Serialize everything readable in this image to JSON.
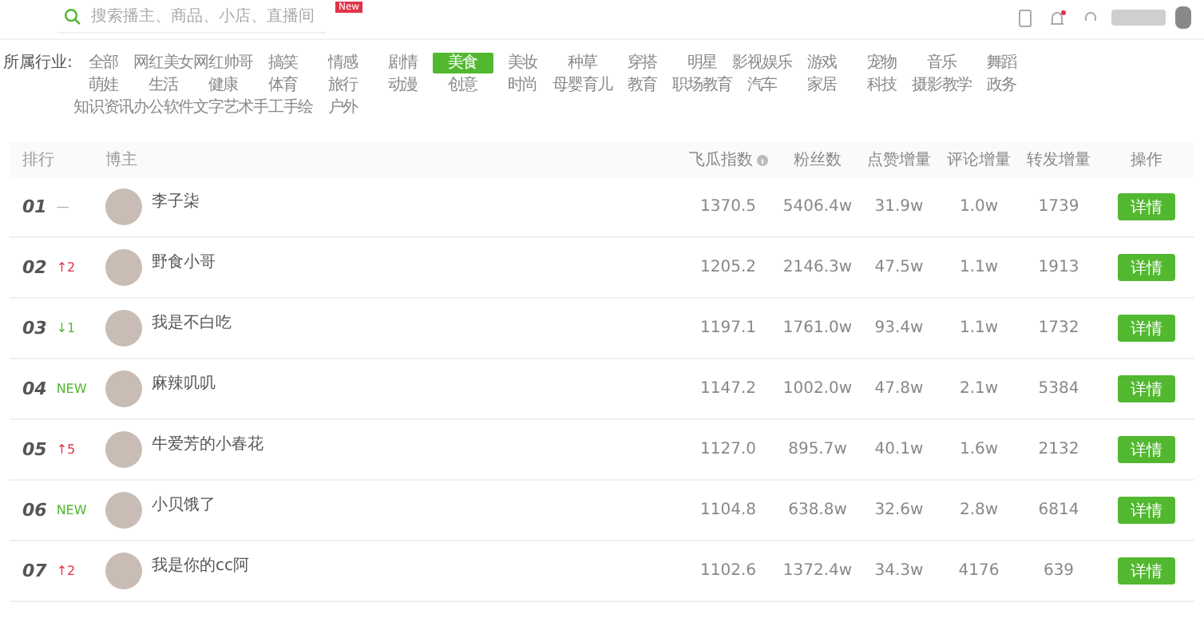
{
  "search": {
    "placeholder": "搜索播主、商品、小店、直播间"
  },
  "new_badge": "New",
  "industry": {
    "label": "所属行业:",
    "rows": [
      [
        {
          "label": "全部",
          "selected": false
        },
        {
          "label": "网红美女",
          "selected": false
        },
        {
          "label": "网红帅哥",
          "selected": false
        },
        {
          "label": "搞笑",
          "selected": false
        },
        {
          "label": "情感",
          "selected": false
        },
        {
          "label": "剧情",
          "selected": false
        },
        {
          "label": "美食",
          "selected": true
        },
        {
          "label": "美妆",
          "selected": false
        },
        {
          "label": "种草",
          "selected": false
        },
        {
          "label": "穿搭",
          "selected": false
        },
        {
          "label": "明星",
          "selected": false
        },
        {
          "label": "影视娱乐",
          "selected": false
        },
        {
          "label": "游戏",
          "selected": false
        },
        {
          "label": "宠物",
          "selected": false
        },
        {
          "label": "音乐",
          "selected": false
        },
        {
          "label": "舞蹈",
          "selected": false
        }
      ],
      [
        {
          "label": "萌娃",
          "selected": false
        },
        {
          "label": "生活",
          "selected": false
        },
        {
          "label": "健康",
          "selected": false
        },
        {
          "label": "体育",
          "selected": false
        },
        {
          "label": "旅行",
          "selected": false
        },
        {
          "label": "动漫",
          "selected": false
        },
        {
          "label": "创意",
          "selected": false
        },
        {
          "label": "时尚",
          "selected": false
        },
        {
          "label": "母婴育儿",
          "selected": false
        },
        {
          "label": "教育",
          "selected": false
        },
        {
          "label": "职场教育",
          "selected": false
        },
        {
          "label": "汽车",
          "selected": false
        },
        {
          "label": "家居",
          "selected": false
        },
        {
          "label": "科技",
          "selected": false
        },
        {
          "label": "摄影教学",
          "selected": false
        },
        {
          "label": "政务",
          "selected": false
        }
      ],
      [
        {
          "label": "知识资讯",
          "selected": false
        },
        {
          "label": "办公软件",
          "selected": false
        },
        {
          "label": "文字艺术",
          "selected": false
        },
        {
          "label": "手工手绘",
          "selected": false
        },
        {
          "label": "户外",
          "selected": false
        }
      ]
    ]
  },
  "table": {
    "columns": [
      "排行",
      "博主",
      "飞瓜指数",
      "粉丝数",
      "点赞增量",
      "评论增量",
      "转发增量",
      "操作"
    ],
    "rows": [
      {
        "rank": "01",
        "change": {
          "kind": "same",
          "text": "—"
        },
        "name": "李子柒",
        "index": "1370.5",
        "fans": "5406.4w",
        "likes": "31.9w",
        "comments": "1.0w",
        "shares": "1739",
        "action": "详情"
      },
      {
        "rank": "02",
        "change": {
          "kind": "up",
          "text": "↑2"
        },
        "name": "野食小哥",
        "index": "1205.2",
        "fans": "2146.3w",
        "likes": "47.5w",
        "comments": "1.1w",
        "shares": "1913",
        "action": "详情"
      },
      {
        "rank": "03",
        "change": {
          "kind": "down",
          "text": "↓1"
        },
        "name": "我是不白吃",
        "index": "1197.1",
        "fans": "1761.0w",
        "likes": "93.4w",
        "comments": "1.1w",
        "shares": "1732",
        "action": "详情"
      },
      {
        "rank": "04",
        "change": {
          "kind": "new",
          "text": "NEW"
        },
        "name": "麻辣叽叽",
        "index": "1147.2",
        "fans": "1002.0w",
        "likes": "47.8w",
        "comments": "2.1w",
        "shares": "5384",
        "action": "详情"
      },
      {
        "rank": "05",
        "change": {
          "kind": "up",
          "text": "↑5"
        },
        "name": "牛爱芳的小春花",
        "index": "1127.0",
        "fans": "895.7w",
        "likes": "40.1w",
        "comments": "1.6w",
        "shares": "2132",
        "action": "详情"
      },
      {
        "rank": "06",
        "change": {
          "kind": "new",
          "text": "NEW"
        },
        "name": "小贝饿了",
        "index": "1104.8",
        "fans": "638.8w",
        "likes": "32.6w",
        "comments": "2.8w",
        "shares": "6814",
        "action": "详情"
      },
      {
        "rank": "07",
        "change": {
          "kind": "up",
          "text": "↑2"
        },
        "name": "我是你的cc阿",
        "index": "1102.6",
        "fans": "1372.4w",
        "likes": "34.3w",
        "comments": "4176",
        "shares": "639",
        "action": "详情"
      }
    ]
  }
}
